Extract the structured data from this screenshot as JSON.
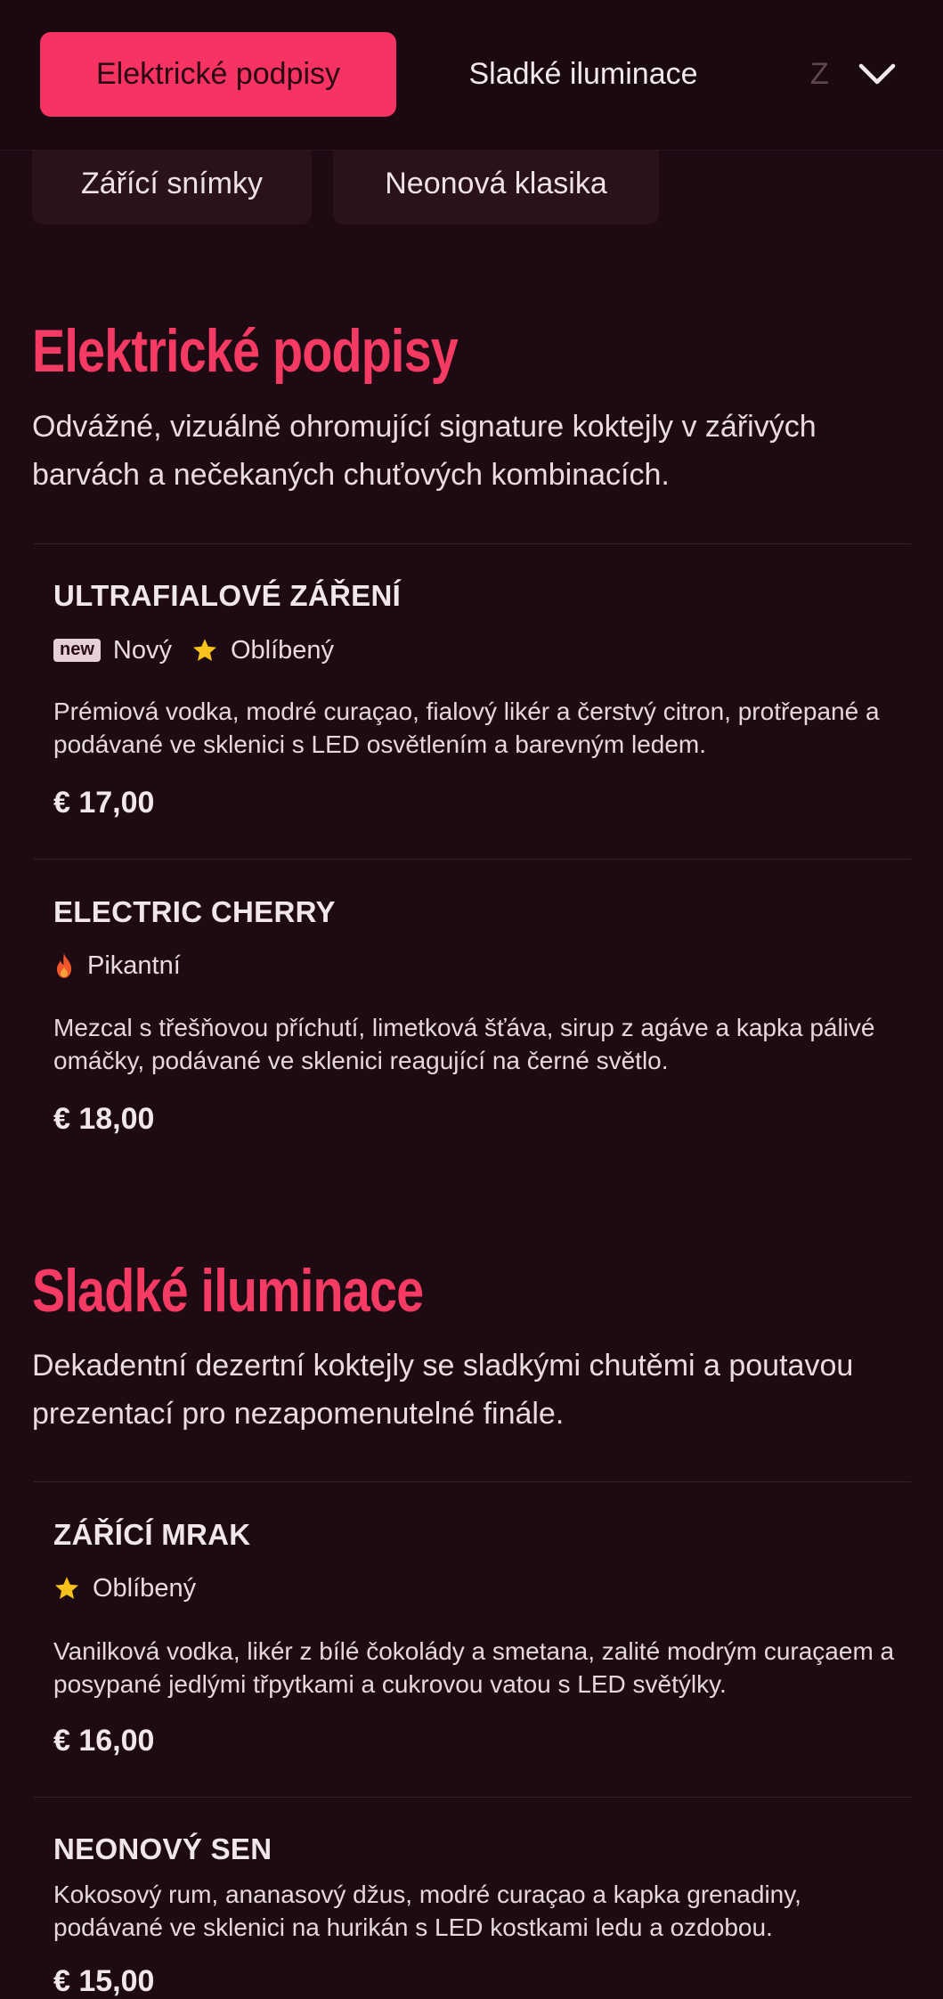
{
  "tabs": [
    {
      "label": "Elektrické podpisy",
      "active": true
    },
    {
      "label": "Sladké iluminace",
      "active": false
    },
    {
      "label": "Z",
      "active": false
    }
  ],
  "chips": [
    "Zářící snímky",
    "Neonová klasika"
  ],
  "colors": {
    "background": "#1e0a12",
    "accent": "#f73363",
    "heading": "#f53a63",
    "star": "#f7c21b",
    "flame": "#f1562a"
  },
  "icons": {
    "expand": "chevron-down-icon",
    "favorite": "star-icon",
    "spicy": "flame-icon"
  },
  "sections": [
    {
      "title": "Elektrické podpisy",
      "description": "Odvážné, vizuálně ohromující signature koktejly v zářivých barvách a nečekaných chuťových kombinacích.",
      "items": [
        {
          "name": "ULTRAFIALOVÉ ZÁŘENÍ",
          "badge_new": "new",
          "badge_new_label": "Nový",
          "badge_fav_label": "Oblíbený",
          "description": "Prémiová vodka, modré curaçao, fialový likér a čerstvý citron, protřepané a podávané ve sklenici s LED osvětlením a barevným ledem.",
          "price": "€ 17,00"
        },
        {
          "name": "ELECTRIC CHERRY",
          "badge_spicy_label": "Pikantní",
          "description": "Mezcal s třešňovou příchutí, limetková šťáva, sirup z agáve a kapka pálivé omáčky, podávané ve sklenici reagující na černé světlo.",
          "price": "€ 18,00"
        }
      ]
    },
    {
      "title": "Sladké iluminace",
      "description": "Dekadentní dezertní koktejly se sladkými chutěmi a poutavou prezentací pro nezapomenutelné finále.",
      "items": [
        {
          "name": "ZÁŘÍCÍ MRAK",
          "badge_fav_label": "Oblíbený",
          "description": "Vanilková vodka, likér z bílé čokolády a smetana, zalité modrým curaçaem a posypané jedlými třpytkami a cukrovou vatou s LED světýlky.",
          "price": "€ 16,00"
        },
        {
          "name": "NEONOVÝ SEN",
          "description": "Kokosový rum, ananasový džus, modré curaçao a kapka grenadiny, podávané ve sklenici na hurikán s LED kostkami ledu a ozdobou.",
          "price": "€ 15,00"
        }
      ]
    }
  ]
}
